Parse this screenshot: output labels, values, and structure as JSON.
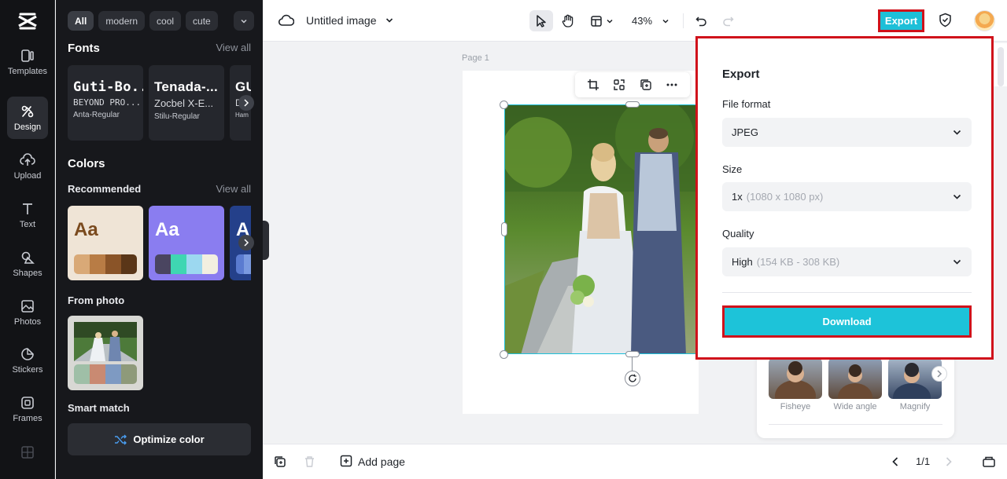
{
  "rail": {
    "items": [
      {
        "label": "Templates"
      },
      {
        "label": "Design"
      },
      {
        "label": "Upload"
      },
      {
        "label": "Text"
      },
      {
        "label": "Shapes"
      },
      {
        "label": "Photos"
      },
      {
        "label": "Stickers"
      },
      {
        "label": "Frames"
      }
    ]
  },
  "panel": {
    "tags": [
      "All",
      "modern",
      "cool",
      "cute"
    ],
    "fonts_title": "Fonts",
    "view_all": "View all",
    "font_cards": [
      {
        "big": "Guti-Bo...",
        "mid": "BEYOND PRO...",
        "small": "Anta-Regular"
      },
      {
        "big": "Tenada-...",
        "mid": "Zocbel X-E...",
        "small": "Stilu-Regular"
      },
      {
        "big": "GU",
        "mid": "D",
        "small": "Ham"
      }
    ],
    "colors_title": "Colors",
    "recommended": "Recommended",
    "color_cards": [
      {
        "aa": "Aa",
        "bg": "#efe4d6",
        "fg": "#7a4a1e",
        "swatches": [
          "#d9a977",
          "#b87c45",
          "#8a5428",
          "#5a3618"
        ]
      },
      {
        "aa": "Aa",
        "bg": "#8a7df0",
        "fg": "#ffffff",
        "swatches": [
          "#4a4560",
          "#3fd6b2",
          "#9cd8f0",
          "#f2efe0"
        ]
      },
      {
        "aa": "A",
        "bg": "#24408a",
        "fg": "#ffffff",
        "swatches": [
          "#5a7bd0",
          "#7a9ae0"
        ]
      }
    ],
    "from_photo": "From photo",
    "photo_swatches": [
      "#9fbfa7",
      "#c98a72",
      "#7e9ac2",
      "#8e9a7a"
    ],
    "smart_match": "Smart match",
    "optimize": "Optimize color"
  },
  "topbar": {
    "doc_title": "Untitled image",
    "zoom": "43%",
    "export": "Export"
  },
  "canvas": {
    "page_label": "Page 1"
  },
  "export_panel": {
    "title": "Export",
    "file_format_label": "File format",
    "file_format_value": "JPEG",
    "size_label": "Size",
    "size_value": "1x",
    "size_hint": "(1080 x 1080 px)",
    "quality_label": "Quality",
    "quality_value": "High",
    "quality_hint": "(154 KB - 308 KB)",
    "download": "Download"
  },
  "effects": {
    "items": [
      "Fisheye",
      "Wide angle",
      "Magnify"
    ]
  },
  "bottombar": {
    "add_page": "Add page",
    "pager": "1/1"
  }
}
